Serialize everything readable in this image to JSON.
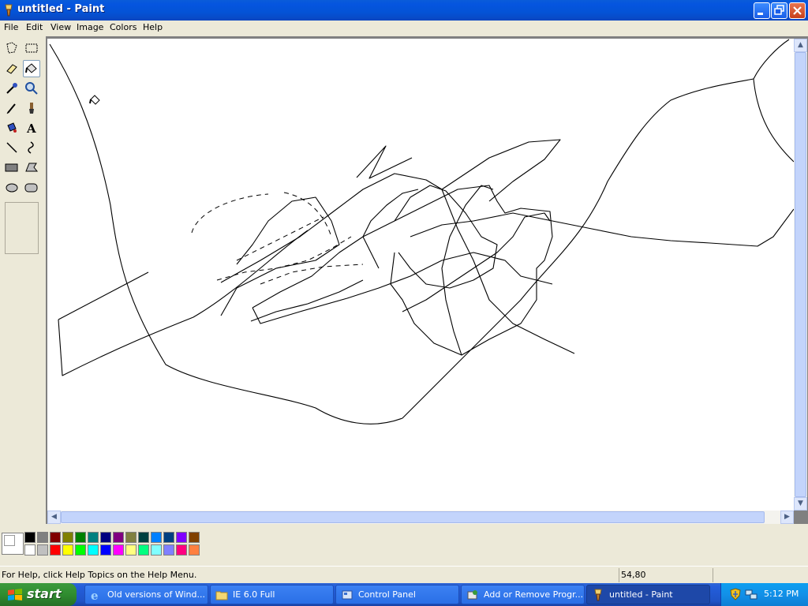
{
  "window": {
    "title": "untitled - Paint"
  },
  "menu": [
    "File",
    "Edit",
    "View",
    "Image",
    "Colors",
    "Help"
  ],
  "tools": [
    "free-form-select",
    "select",
    "eraser",
    "fill-with-color",
    "pick-color",
    "magnifier",
    "pencil",
    "brush",
    "airbrush",
    "text",
    "line",
    "curve",
    "rectangle",
    "polygon",
    "ellipse",
    "rounded-rectangle"
  ],
  "selected_tool": "fill-with-color",
  "palette": {
    "top_row": [
      "#000000",
      "#808080",
      "#800000",
      "#808000",
      "#008000",
      "#008080",
      "#000080",
      "#800080",
      "#808040",
      "#004040",
      "#0080ff",
      "#004080",
      "#8000ff",
      "#804000"
    ],
    "bottom_row": [
      "#ffffff",
      "#c0c0c0",
      "#ff0000",
      "#ffff00",
      "#00ff00",
      "#00ffff",
      "#0000ff",
      "#ff00ff",
      "#ffff80",
      "#00ff80",
      "#80ffff",
      "#8080ff",
      "#ff0080",
      "#ff8040"
    ],
    "foreground": "#ffffff",
    "background": "#ffffff"
  },
  "status": {
    "help": "For Help, click Help Topics on the Help Menu.",
    "coords": "54,80"
  },
  "taskbar": {
    "start": "start",
    "tasks": [
      {
        "label": "Old versions of Wind...",
        "icon": "ie-icon"
      },
      {
        "label": "IE 6.0 Full",
        "icon": "folder-icon"
      },
      {
        "label": "Control Panel",
        "icon": "control-panel-icon"
      },
      {
        "label": "Add or Remove Progr...",
        "icon": "add-remove-icon"
      },
      {
        "label": "untitled - Paint",
        "icon": "paint-icon"
      }
    ],
    "clock": "5:12 PM"
  }
}
